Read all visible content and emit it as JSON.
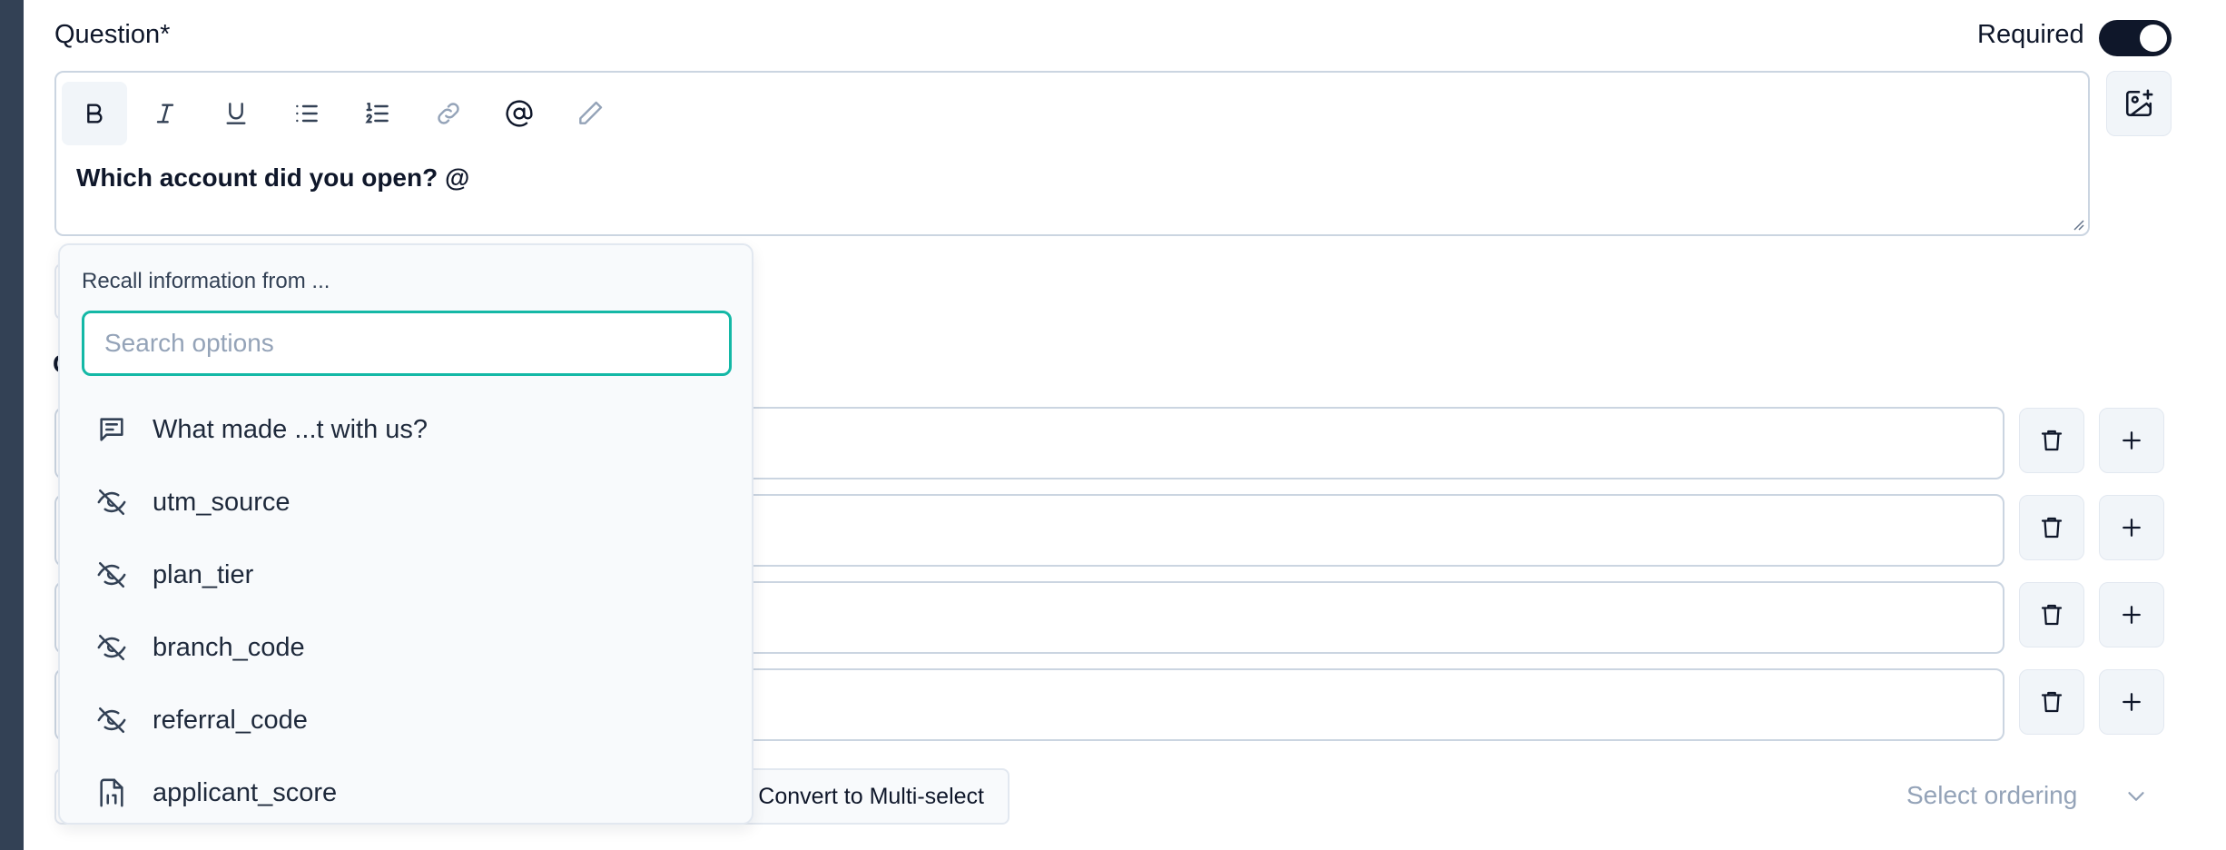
{
  "question": {
    "label": "Question*",
    "required_label": "Required",
    "required_on": true,
    "text": "Which account did you open? @"
  },
  "toolbar": {
    "icons": [
      "bold-icon",
      "italic-icon",
      "underline-icon",
      "bullet-list-icon",
      "numbered-list-icon",
      "link-icon",
      "mention-icon",
      "pencil-icon"
    ]
  },
  "choices": {
    "rows": 4,
    "behind_label": "C"
  },
  "footer": {
    "convert_label": "Convert to Multi-select",
    "ordering_placeholder": "Select ordering"
  },
  "recall": {
    "title": "Recall information from ...",
    "search_placeholder": "Search options",
    "search_value": "",
    "items": [
      {
        "label": "What made ...t with us?",
        "icon": "message-icon"
      },
      {
        "label": "utm_source",
        "icon": "eye-off-icon"
      },
      {
        "label": "plan_tier",
        "icon": "eye-off-icon"
      },
      {
        "label": "branch_code",
        "icon": "eye-off-icon"
      },
      {
        "label": "referral_code",
        "icon": "eye-off-icon"
      },
      {
        "label": "applicant_score",
        "icon": "file-digit-icon"
      }
    ]
  },
  "colors": {
    "accent": "#14b8a6",
    "dark": "#0f172a",
    "sidebar": "#334155"
  }
}
